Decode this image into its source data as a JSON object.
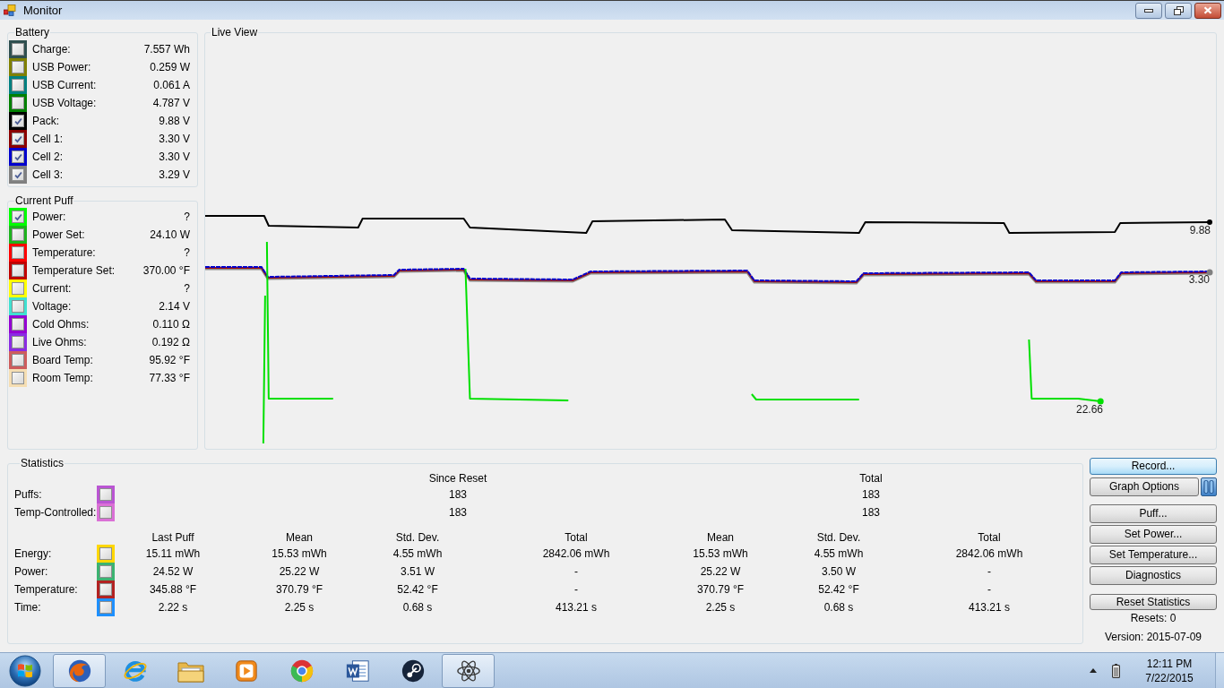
{
  "window": {
    "title": "Monitor"
  },
  "battery": {
    "title": "Battery",
    "items": [
      {
        "label": "Charge:",
        "value": "7.557 Wh",
        "color": "#2f4f4f",
        "checked": false
      },
      {
        "label": "USB Power:",
        "value": "0.259 W",
        "color": "#808000",
        "checked": false
      },
      {
        "label": "USB Current:",
        "value": "0.061 A",
        "color": "#008080",
        "checked": false
      },
      {
        "label": "USB Voltage:",
        "value": "4.787 V",
        "color": "#008000",
        "checked": false
      },
      {
        "label": "Pack:",
        "value": "9.88 V",
        "color": "#000000",
        "checked": true
      },
      {
        "label": "Cell 1:",
        "value": "3.30 V",
        "color": "#8b0000",
        "checked": true
      },
      {
        "label": "Cell 2:",
        "value": "3.30 V",
        "color": "#0000cd",
        "checked": true
      },
      {
        "label": "Cell 3:",
        "value": "3.29 V",
        "color": "#808080",
        "checked": true
      }
    ]
  },
  "current_puff": {
    "title": "Current Puff",
    "items": [
      {
        "label": "Power:",
        "value": "?",
        "color": "#00ff00",
        "checked": true
      },
      {
        "label": "Power Set:",
        "value": "24.10 W",
        "color": "#1db31d",
        "checked": false
      },
      {
        "label": "Temperature:",
        "value": "?",
        "color": "#ff0000",
        "checked": false
      },
      {
        "label": "Temperature Set:",
        "value": "370.00 °F",
        "color": "#c00000",
        "checked": false
      },
      {
        "label": "Current:",
        "value": "?",
        "color": "#ffff00",
        "checked": false
      },
      {
        "label": "Voltage:",
        "value": "2.14 V",
        "color": "#40e0d0",
        "checked": false
      },
      {
        "label": "Cold Ohms:",
        "value": "0.110 Ω",
        "color": "#9400d3",
        "checked": false
      },
      {
        "label": "Live Ohms:",
        "value": "0.192 Ω",
        "color": "#8a2be2",
        "checked": false
      },
      {
        "label": "Board Temp:",
        "value": "95.92 °F",
        "color": "#cd5c5c",
        "checked": false
      },
      {
        "label": "Room Temp:",
        "value": "77.33 °F",
        "color": "#f5deb3",
        "checked": false
      }
    ]
  },
  "live_view": {
    "title": "Live View",
    "end_labels": [
      "9.88",
      "3.30",
      "22.66"
    ]
  },
  "statistics": {
    "title": "Statistics",
    "group_headers": [
      "Since Reset",
      "Total"
    ],
    "counts": [
      {
        "label": "Puffs:",
        "color": "#ba55d3",
        "checked": false,
        "since_reset": "183",
        "total": "183"
      },
      {
        "label": "Temp-Controlled:",
        "color": "#da70d6",
        "checked": false,
        "since_reset": "183",
        "total": "183"
      }
    ],
    "columns": [
      "Last Puff",
      "Mean",
      "Std. Dev.",
      "Total",
      "Mean",
      "Std. Dev.",
      "Total"
    ],
    "rows": [
      {
        "label": "Energy:",
        "color": "#ffd700",
        "checked": false,
        "cells": [
          "15.11 mWh",
          "15.53 mWh",
          "4.55 mWh",
          "2842.06 mWh",
          "15.53 mWh",
          "4.55 mWh",
          "2842.06 mWh"
        ]
      },
      {
        "label": "Power:",
        "color": "#3cb371",
        "checked": false,
        "cells": [
          "24.52 W",
          "25.22 W",
          "3.51 W",
          "-",
          "25.22 W",
          "3.50 W",
          "-"
        ]
      },
      {
        "label": "Temperature:",
        "color": "#b22222",
        "checked": false,
        "cells": [
          "345.88 °F",
          "370.79 °F",
          "52.42 °F",
          "-",
          "370.79 °F",
          "52.42 °F",
          "-"
        ]
      },
      {
        "label": "Time:",
        "color": "#1e90ff",
        "checked": false,
        "cells": [
          "2.22 s",
          "2.25 s",
          "0.68 s",
          "413.21 s",
          "2.25 s",
          "0.68 s",
          "413.21 s"
        ]
      }
    ]
  },
  "controls": {
    "record": {
      "label": "Record...",
      "highlighted": true
    },
    "graph_options": "Graph Options",
    "actions": [
      "Puff...",
      "Set Power...",
      "Set Temperature...",
      "Diagnostics"
    ],
    "reset": "Reset Statistics",
    "resets": "Resets: 0",
    "version": "Version: 2015-07-09"
  },
  "taskbar": {
    "apps": [
      {
        "kind": "firefox",
        "running": true
      },
      {
        "kind": "ie",
        "running": false
      },
      {
        "kind": "folder",
        "running": false
      },
      {
        "kind": "media",
        "running": false
      },
      {
        "kind": "chrome",
        "running": false
      },
      {
        "kind": "word",
        "running": false
      },
      {
        "kind": "steam",
        "running": false
      },
      {
        "kind": "atom",
        "running": true
      }
    ],
    "time": "12:11 PM",
    "date": "7/22/2015"
  }
}
